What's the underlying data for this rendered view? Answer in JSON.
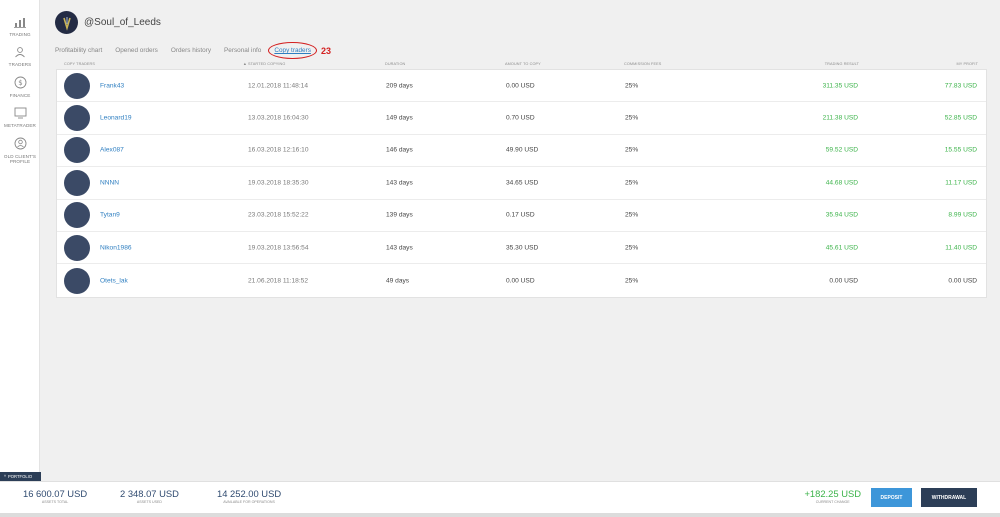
{
  "sidebar": {
    "items": [
      {
        "label": "TRADING",
        "icon": "chart-icon"
      },
      {
        "label": "TRADERS",
        "icon": "traders-icon"
      },
      {
        "label": "FINANCE",
        "icon": "dollar-icon"
      },
      {
        "label": "METATRADER",
        "icon": "monitor-icon"
      },
      {
        "label": "OLD CLIENT'S PROFILE",
        "icon": "profile-icon"
      }
    ]
  },
  "profile": {
    "username": "@Soul_of_Leeds"
  },
  "tabs": [
    {
      "label": "Profitability chart"
    },
    {
      "label": "Opened orders"
    },
    {
      "label": "Orders history"
    },
    {
      "label": "Personal info"
    },
    {
      "label": "Copy traders"
    }
  ],
  "annotation": "23",
  "table": {
    "headers": {
      "copy_traders": "COPY TRADERS",
      "started": "▲ STARTED COPYING",
      "duration": "DURATION",
      "amount": "AMOUNT TO COPY",
      "fees": "COMMISSION FEES",
      "result": "TRADING RESULT",
      "profit": "MY PROFIT"
    },
    "rows": [
      {
        "name": "Frank43",
        "started": "12.01.2018 11:48:14",
        "duration": "209 days",
        "amount": "0.00 USD",
        "fee": "25%",
        "result": "311.35 USD",
        "profit": "77.83 USD"
      },
      {
        "name": "Leonard19",
        "started": "13.03.2018 16:04:30",
        "duration": "149 days",
        "amount": "0.70 USD",
        "fee": "25%",
        "result": "211.38 USD",
        "profit": "52.85 USD"
      },
      {
        "name": "Alex087",
        "started": "16.03.2018 12:16:10",
        "duration": "146 days",
        "amount": "49.90 USD",
        "fee": "25%",
        "result": "59.52 USD",
        "profit": "15.55 USD"
      },
      {
        "name": "NNNN",
        "started": "19.03.2018 18:35:30",
        "duration": "143 days",
        "amount": "34.65 USD",
        "fee": "25%",
        "result": "44.68 USD",
        "profit": "11.17 USD"
      },
      {
        "name": "Tytan9",
        "started": "23.03.2018 15:52:22",
        "duration": "139 days",
        "amount": "0.17 USD",
        "fee": "25%",
        "result": "35.94 USD",
        "profit": "8.99 USD"
      },
      {
        "name": "Nikon1986",
        "started": "19.03.2018 13:56:54",
        "duration": "143 days",
        "amount": "35.30 USD",
        "fee": "25%",
        "result": "45.61 USD",
        "profit": "11.40 USD"
      },
      {
        "name": "Otets_lak",
        "started": "21.06.2018 11:18:52",
        "duration": "49 days",
        "amount": "0.00 USD",
        "fee": "25%",
        "result": "0.00 USD",
        "profit": "0.00 USD"
      }
    ]
  },
  "footer": {
    "portfolio_label": "PORTFOLIO",
    "assets_total": {
      "value": "16 600.07 USD",
      "label": "ASSETS TOTAL"
    },
    "assets_used": {
      "value": "2 348.07 USD",
      "label": "ASSETS USED"
    },
    "available": {
      "value": "14 252.00 USD",
      "label": "AVAILABLE FOR OPERATIONS"
    },
    "current_change": {
      "value": "+182.25 USD",
      "label": "CURRENT CHANGE"
    },
    "deposit_label": "DEPOSIT",
    "withdrawal_label": "WITHDRAWAL"
  },
  "colors": {
    "accent": "#2f7fc1",
    "positive": "#3cb34a",
    "dark": "#2c3e57",
    "annotation": "#d32020"
  }
}
